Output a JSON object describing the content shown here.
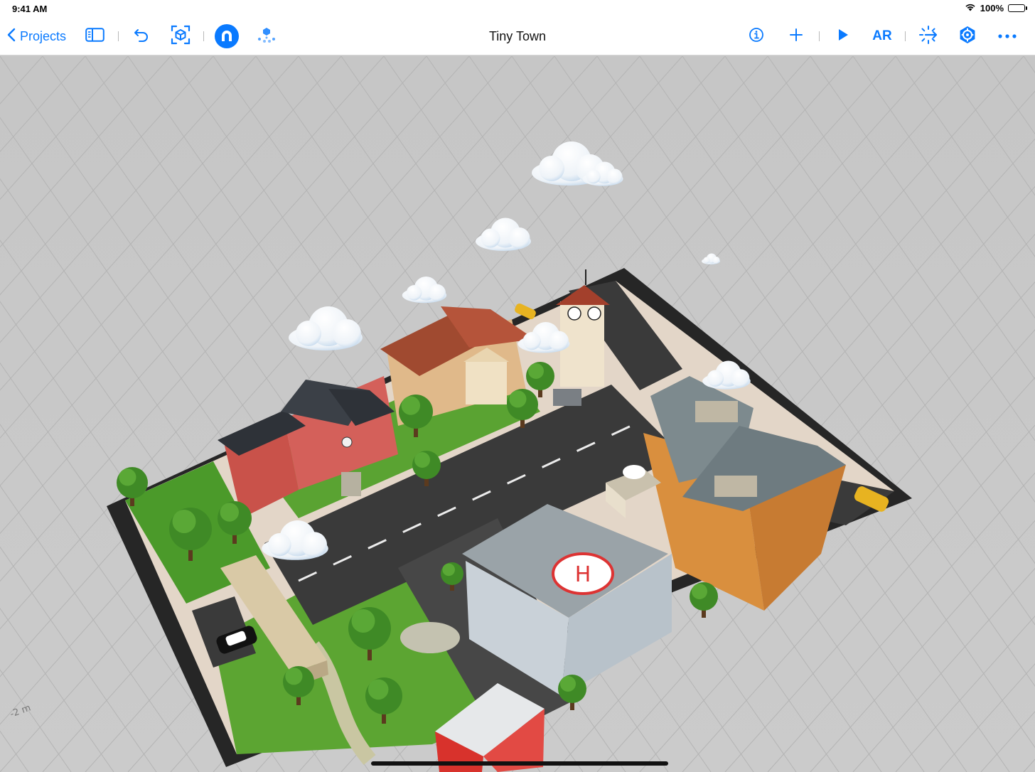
{
  "status_bar": {
    "time": "9:41 AM",
    "battery_percent": "100%"
  },
  "toolbar": {
    "back_label": "Projects",
    "title": "Tiny Town",
    "ar_label": "AR",
    "accent_color": "#0a7aff",
    "left_icons": [
      "chevron-left-icon",
      "sidebar-icon",
      "undo-icon",
      "frame-object-icon",
      "snap-magnet-icon",
      "physics-icon"
    ],
    "right_icons": [
      "info-icon",
      "plus-icon",
      "play-icon",
      "anchor-icon",
      "settings-icon",
      "more-icon"
    ]
  },
  "viewport": {
    "scene_name": "Tiny Town",
    "axis_label": "-2 m"
  }
}
